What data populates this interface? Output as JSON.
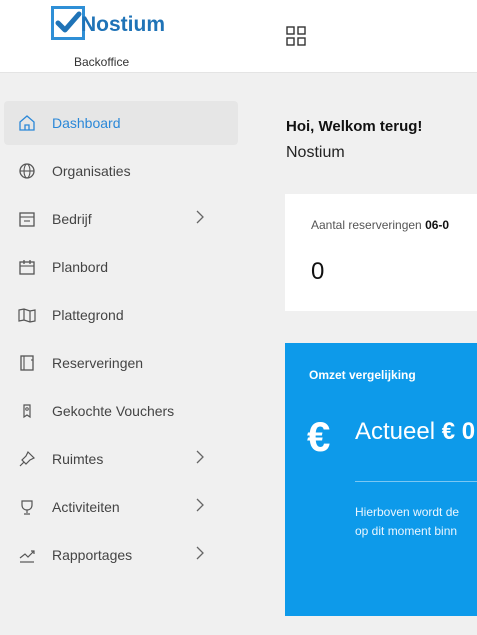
{
  "header": {
    "brand": "Nostium",
    "subtitle": "Backoffice"
  },
  "sidebar": {
    "items": [
      {
        "label": "Dashboard",
        "icon": "home-icon",
        "active": true
      },
      {
        "label": "Organisaties",
        "icon": "globe-icon"
      },
      {
        "label": "Bedrijf",
        "icon": "building-icon",
        "chevron": true
      },
      {
        "label": "Planbord",
        "icon": "calendar-icon"
      },
      {
        "label": "Plattegrond",
        "icon": "map-icon"
      },
      {
        "label": "Reserveringen",
        "icon": "book-icon"
      },
      {
        "label": "Gekochte Vouchers",
        "icon": "voucher-icon"
      },
      {
        "label": "Ruimtes",
        "icon": "pin-icon",
        "chevron": true
      },
      {
        "label": "Activiteiten",
        "icon": "trophy-icon",
        "chevron": true
      },
      {
        "label": "Rapportages",
        "icon": "chart-line-icon",
        "chevron": true
      }
    ]
  },
  "main": {
    "greeting": "Hoi, Welkom terug!",
    "org_name": "Nostium",
    "reservations": {
      "label": "Aantal reserveringen",
      "date": "06-0",
      "value": "0"
    },
    "revenue": {
      "title": "Omzet vergelijking",
      "currency": "€",
      "actual_label": "Actueel",
      "actual_value": "€ 0",
      "description_line1": "Hierboven wordt de",
      "description_line2": "op dit moment binn"
    }
  },
  "colors": {
    "accent": "#2b88d8",
    "revenue_card": "#0d9aea",
    "sidebar_bg": "#f0f0f0"
  }
}
